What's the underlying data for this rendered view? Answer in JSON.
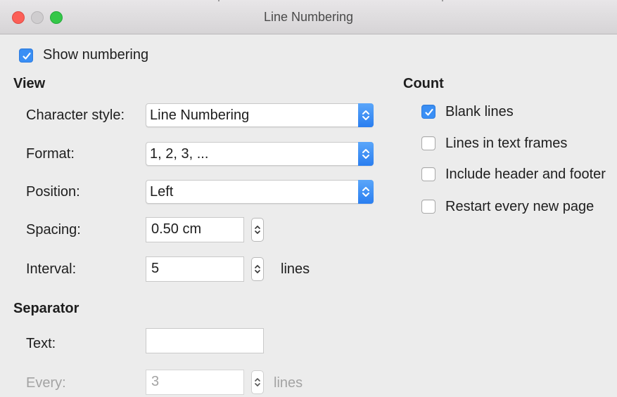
{
  "window": {
    "title": "Line Numbering"
  },
  "show_numbering": {
    "label": "Show numbering",
    "checked": true
  },
  "view": {
    "heading": "View",
    "character_style": {
      "label": "Character style:",
      "value": "Line Numbering"
    },
    "format": {
      "label": "Format:",
      "value": "1, 2, 3, ..."
    },
    "position": {
      "label": "Position:",
      "value": "Left"
    },
    "spacing": {
      "label": "Spacing:",
      "value": "0.50 cm"
    },
    "interval": {
      "label": "Interval:",
      "value": "5",
      "unit": "lines"
    }
  },
  "separator": {
    "heading": "Separator",
    "text": {
      "label": "Text:",
      "value": ""
    },
    "every": {
      "label": "Every:",
      "value": "3",
      "unit": "lines"
    }
  },
  "count": {
    "heading": "Count",
    "items": [
      {
        "label": "Blank lines",
        "checked": true
      },
      {
        "label": "Lines in text frames",
        "checked": false
      },
      {
        "label": "Include header and footer",
        "checked": false
      },
      {
        "label": "Restart every new page",
        "checked": false
      }
    ]
  },
  "colors": {
    "accent": "#3a8ff5",
    "close": "#fc5f57",
    "maximize": "#34c748"
  }
}
